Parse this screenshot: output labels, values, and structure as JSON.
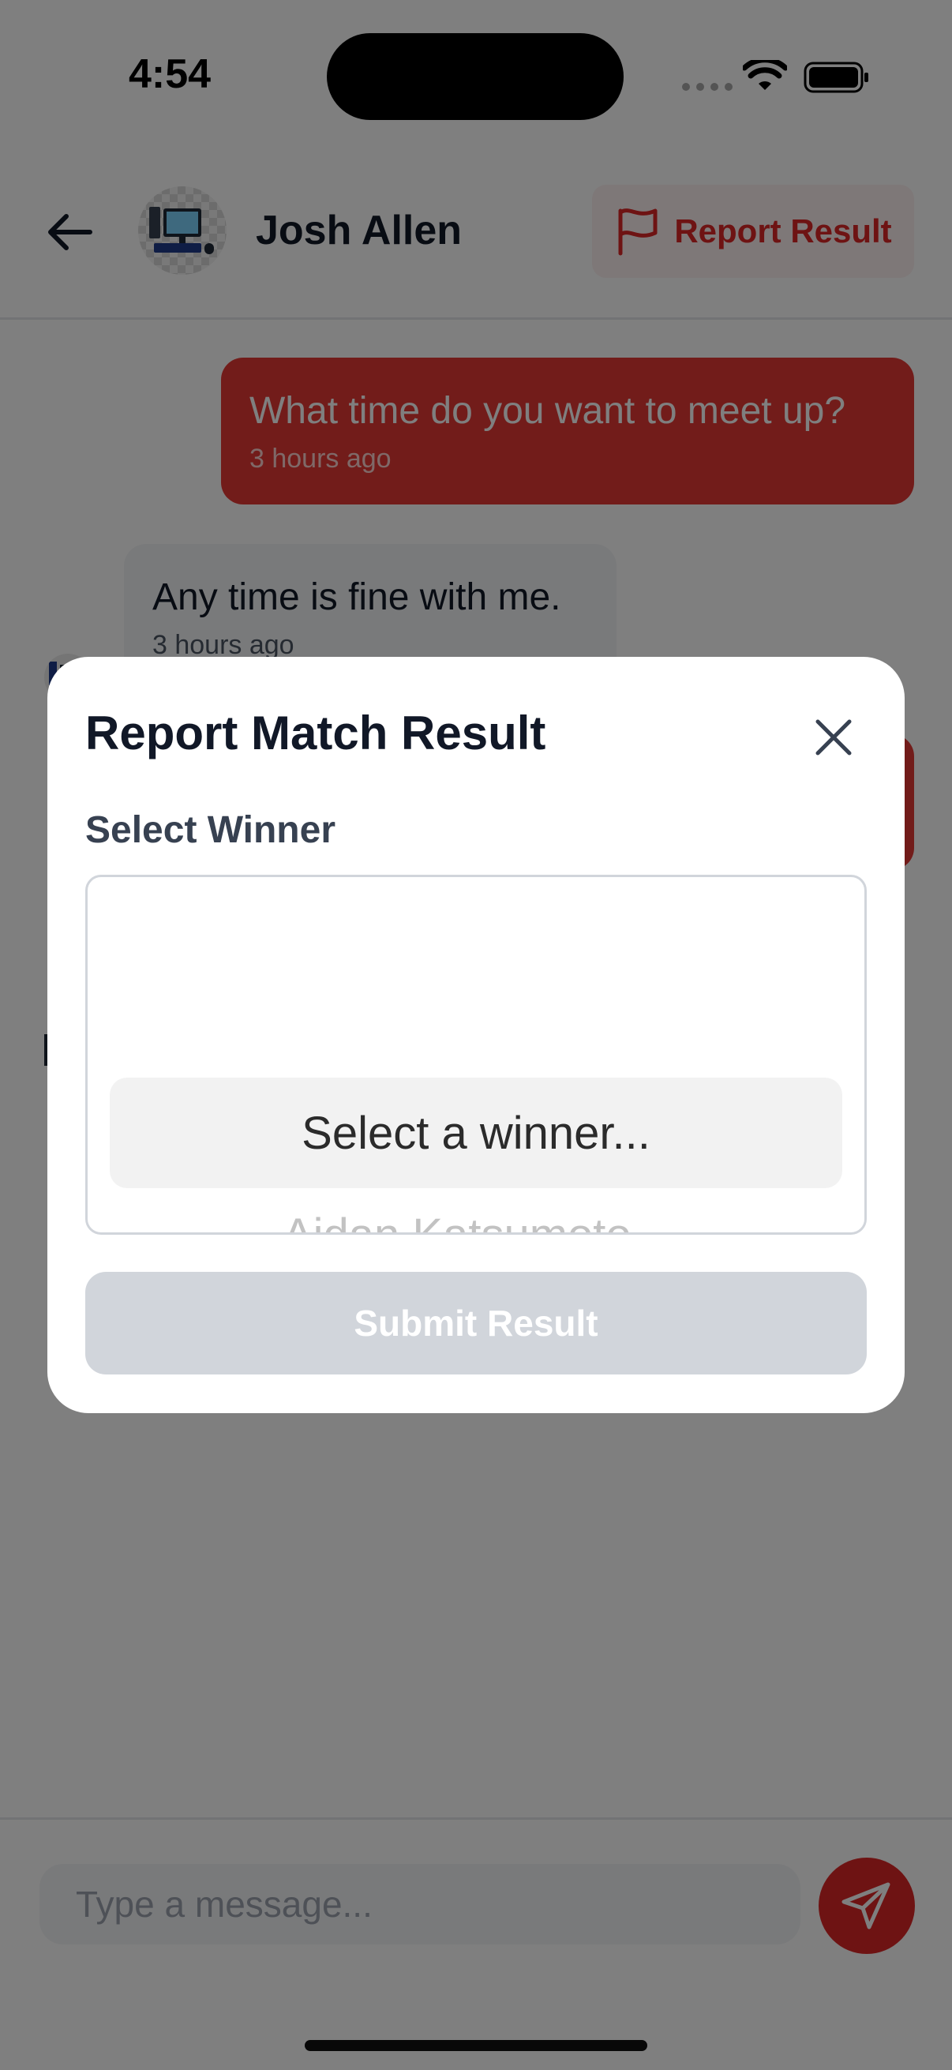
{
  "status_bar": {
    "time": "4:54"
  },
  "header": {
    "name": "Josh Allen",
    "report_label": "Report Result"
  },
  "messages": [
    {
      "text": "What time do you want to meet up?",
      "time": "3 hours ago",
      "direction": "outgoing"
    },
    {
      "text": "Any time is fine with me.",
      "time": "3 hours ago",
      "direction": "incoming"
    }
  ],
  "composer": {
    "placeholder": "Type a message..."
  },
  "modal": {
    "title": "Report Match Result",
    "field_label": "Select Winner",
    "picker_options": [
      "Select a winner...",
      "Aidan Katsumoto..."
    ],
    "submit_label": "Submit Result"
  },
  "colors": {
    "accent": "#dc2626",
    "outgoing_bubble": "#e53935",
    "incoming_bubble": "#f3f4f6",
    "overlay": "rgba(0,0,0,0.5)",
    "submit_disabled": "#d1d5db"
  }
}
